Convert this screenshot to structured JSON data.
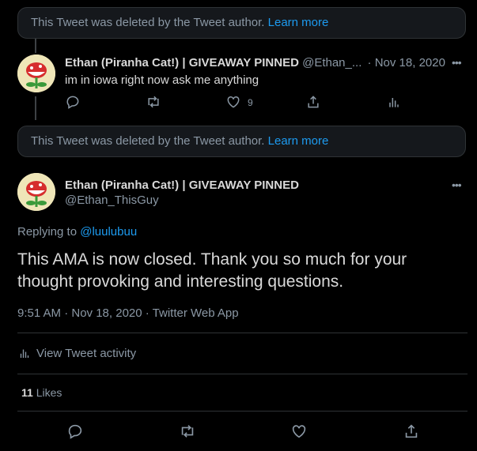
{
  "deleted_notice_1": {
    "text": "This Tweet was deleted by the Tweet author.",
    "link": "Learn more"
  },
  "tweet1": {
    "display_name": "Ethan (Piranha Cat!) | GIVEAWAY PINNED",
    "handle": "@Ethan_...",
    "date": "· Nov 18, 2020",
    "text": "im in iowa right now ask me anything",
    "like_count": "9"
  },
  "deleted_notice_2": {
    "text": "This Tweet was deleted by the Tweet author.",
    "link": "Learn more"
  },
  "main_tweet": {
    "display_name": "Ethan (Piranha Cat!) | GIVEAWAY PINNED",
    "handle": "@Ethan_ThisGuy",
    "replying_prefix": "Replying to",
    "replying_to": "@luulubuu",
    "text": "This AMA is now closed. Thank you so much for your thought provoking and interesting questions.",
    "meta": "9:51 AM · Nov 18, 2020 · Twitter Web App",
    "activity_label": "View Tweet activity",
    "likes_count": "11",
    "likes_label": "Likes"
  },
  "colors": {
    "background": "#000000",
    "accent": "#1d9bf0",
    "muted": "#8b98a5",
    "text": "#d9d9d9"
  }
}
